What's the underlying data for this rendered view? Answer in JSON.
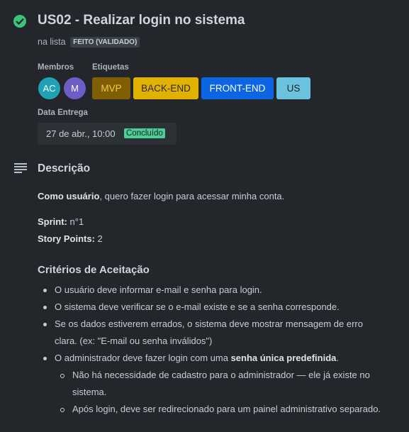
{
  "card": {
    "title": "US02 - Realizar login no sistema",
    "list_prefix": "na lista",
    "list_name": "FEITO (VALIDADO)"
  },
  "members": {
    "label": "Membros",
    "items": [
      {
        "initials": "AC",
        "color": "#1fa2b3"
      },
      {
        "initials": "M",
        "color": "#6e5dc6"
      }
    ]
  },
  "labels": {
    "label": "Etiquetas",
    "items": [
      {
        "text": "MVP",
        "bg": "#7f5f01",
        "fg": "#f5cd47"
      },
      {
        "text": "BACK-END",
        "bg": "#e2b203",
        "fg": "#292a2e"
      },
      {
        "text": "FRONT-END",
        "bg": "#0c66e4",
        "fg": "#ffffff"
      },
      {
        "text": "US",
        "bg": "#6cc3e0",
        "fg": "#1d2125"
      }
    ]
  },
  "due": {
    "label": "Data Entrega",
    "date": "27 de abr., 10:00",
    "status": "Concluído"
  },
  "description": {
    "heading": "Descrição",
    "story_bold": "Como usuário",
    "story_rest": ", quero fazer login para acessar minha conta.",
    "sprint_label": "Sprint:",
    "sprint_value": " n°1",
    "points_label": "Story Points:",
    "points_value": " 2",
    "criteria_heading": "Critérios de Aceitação",
    "criteria": {
      "c1": "O usuário deve informar e-mail e senha para login.",
      "c2": "O sistema deve verificar se o e-mail existe e se a senha corresponde.",
      "c3_line1": "Se os dados estiverem errados, o sistema deve mostrar mensagem de erro",
      "c3_line2": "clara. (ex: \"E-mail ou senha inválidos\")",
      "c4_prefix": "O administrador deve fazer login com uma ",
      "c4_bold": "senha única predefinida",
      "c4_suffix": ".",
      "s1_line1": "Não há necessidade de cadastro para o administrador — ele já existe no",
      "s1_line2": "sistema.",
      "s2": "Após login, deve ser redirecionado para um painel administrativo separado."
    }
  }
}
